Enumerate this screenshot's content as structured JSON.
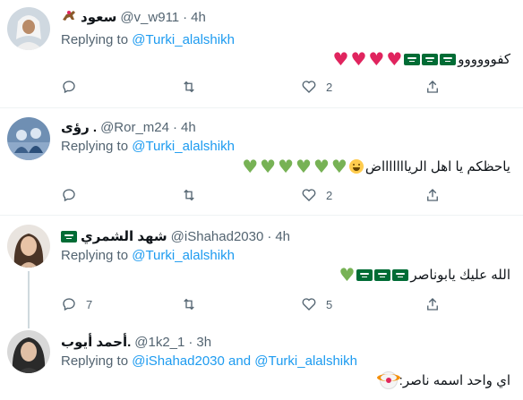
{
  "colors": {
    "accent": "#1d9bf0",
    "muted": "#536471",
    "text": "#0f1419",
    "divider": "#eff3f4"
  },
  "tweets": [
    {
      "name": "سعود",
      "name_emoji": "horse-racing-emoji",
      "handle": "@v_w911",
      "dot": "·",
      "time": "4h",
      "replying_prefix": "Replying to",
      "replying_to": "@Turki_alalshikh",
      "replying_and": "",
      "replying_to_2": "",
      "text": "كفوووووو",
      "trail": [
        "red-heart",
        "red-heart",
        "red-heart",
        "red-heart",
        "saudi-flag",
        "saudi-flag",
        "saudi-flag"
      ],
      "reply_count": "",
      "retweet_count": "",
      "like_count": "2"
    },
    {
      "name": "رؤى .",
      "handle": "@Ror_m24",
      "dot": "·",
      "time": "4h",
      "replying_prefix": "Replying to",
      "replying_to": "@Turki_alalshikh",
      "text": "ياحظكم يا اهل الرياااااااض",
      "trail": [
        "weary-face",
        "green-heart",
        "green-heart",
        "green-heart",
        "green-heart",
        "green-heart",
        "green-heart"
      ],
      "reply_count": "",
      "retweet_count": "",
      "like_count": "2"
    },
    {
      "name": "شهد الشمري",
      "name_emoji": "saudi-flag",
      "handle": "@iShahad2030",
      "dot": "·",
      "time": "4h",
      "replying_prefix": "Replying to",
      "replying_to": "@Turki_alalshikh",
      "text": "الله عليك يابوناصر",
      "trail": [
        "saudi-flag",
        "saudi-flag",
        "saudi-flag",
        "green-heart"
      ],
      "reply_count": "7",
      "retweet_count": "",
      "like_count": "5"
    },
    {
      "name": "أحمد أيوب.",
      "handle": "@1k2_1",
      "dot": "·",
      "time": "3h",
      "replying_prefix": "Replying to",
      "replying_to": "@iShahad2030",
      "replying_and": "and",
      "replying_to_2": "@Turki_alalshikh",
      "text": "اي واحد اسمه ناصر:",
      "trail": [
        "clown-face"
      ]
    }
  ]
}
